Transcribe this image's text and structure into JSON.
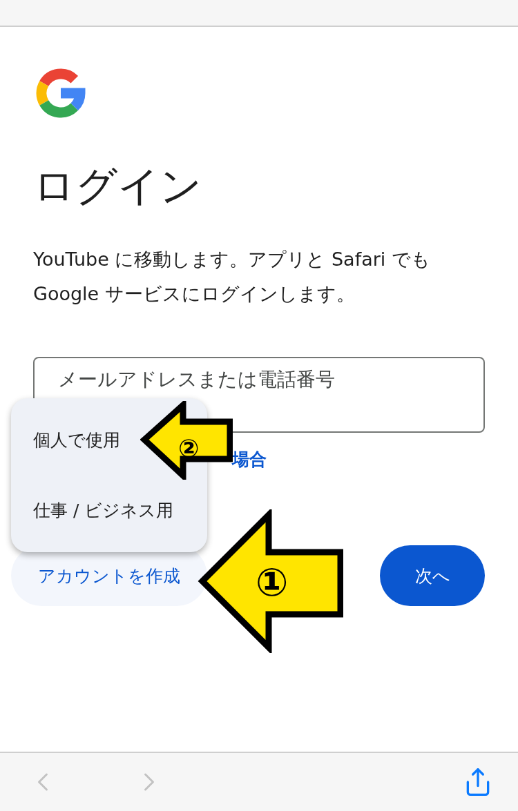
{
  "page": {
    "title": "ログイン",
    "description": "YouTube に移動します。アプリと Safari でも Google サービスにログインします。",
    "email_field": {
      "placeholder": "メールアドレスまたは電話番号"
    },
    "forgot_link": "場合",
    "create_account_button": "アカウントを作成",
    "next_button": "次へ"
  },
  "account_menu": {
    "items": [
      {
        "label": "個人で使用"
      },
      {
        "label": "仕事 / ビジネス用"
      }
    ]
  },
  "annotations": [
    {
      "number": "①"
    },
    {
      "number": "②"
    }
  ],
  "toolbar": {
    "back_disabled": true,
    "forward_disabled": true
  }
}
